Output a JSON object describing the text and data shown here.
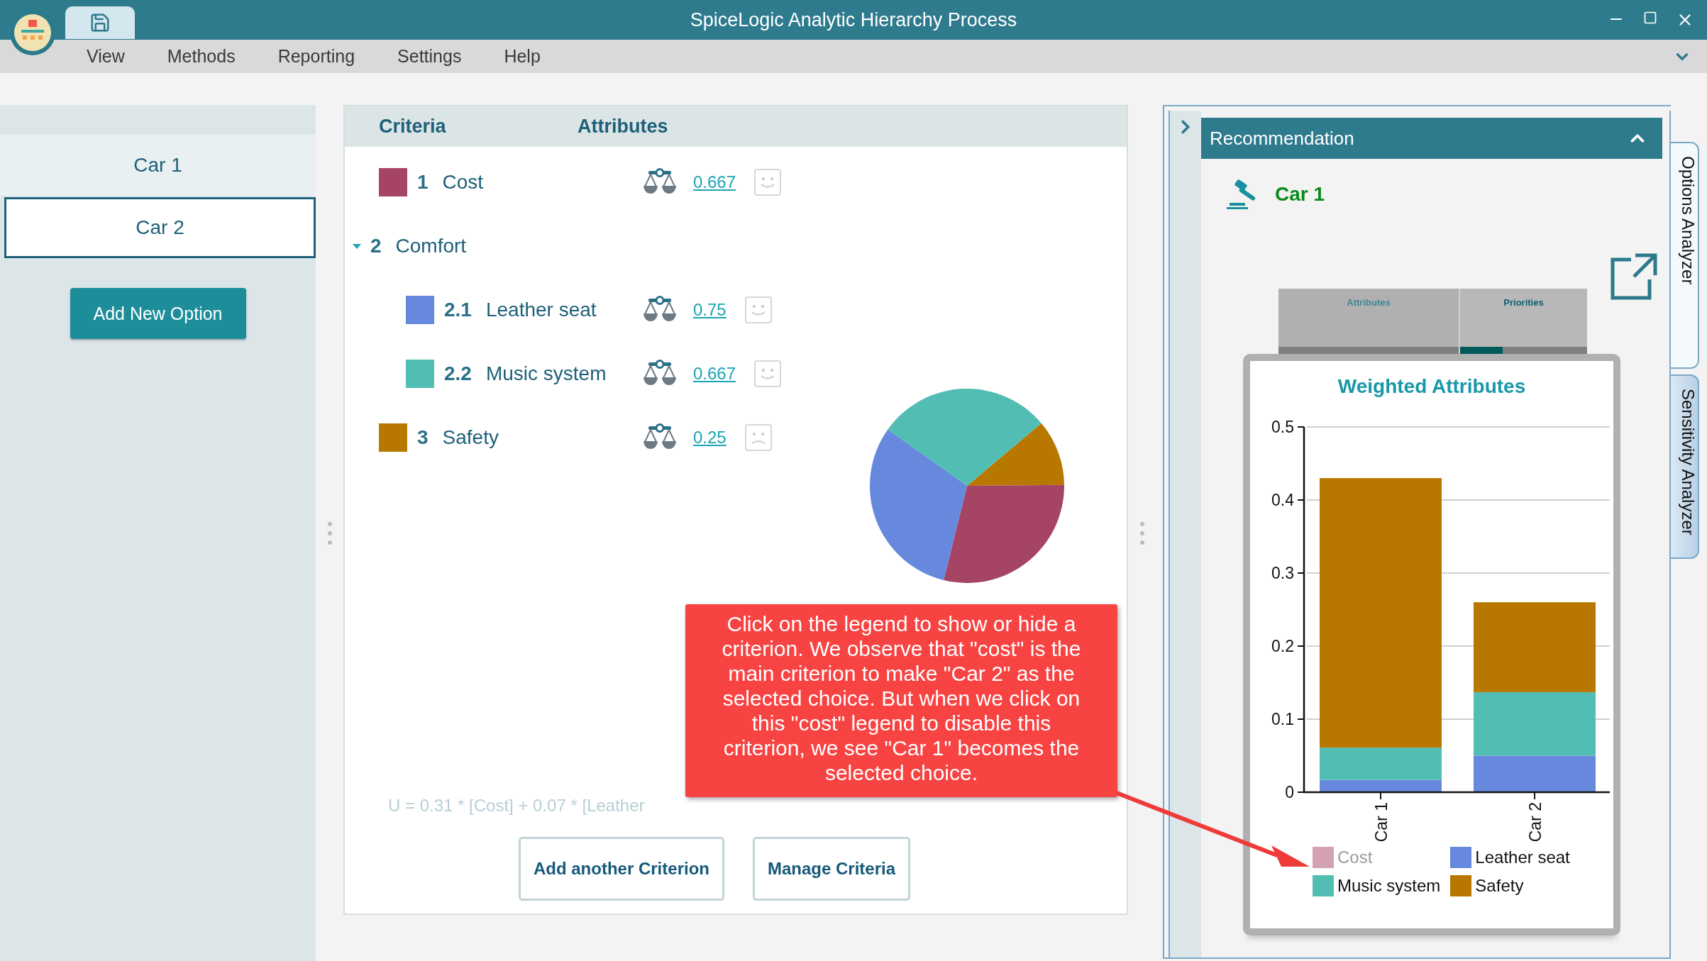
{
  "window": {
    "title": "SpiceLogic Analytic Hierarchy Process"
  },
  "menu": [
    {
      "label": "View"
    },
    {
      "label": "Methods"
    },
    {
      "label": "Reporting"
    },
    {
      "label": "Settings"
    },
    {
      "label": "Help"
    }
  ],
  "options": [
    {
      "label": "Car 1",
      "selected": false
    },
    {
      "label": "Car 2",
      "selected": true
    }
  ],
  "add_option_button": "Add New Option",
  "criteria_panel": {
    "columns": [
      "Criteria",
      "Attributes"
    ],
    "criteria": [
      {
        "number": "1",
        "name": "Cost",
        "color": "#a64466",
        "weight": "0.667",
        "kind": "happy"
      },
      {
        "number": "2",
        "name": "Comfort",
        "expanded": true,
        "children": [
          {
            "number": "2.1",
            "name": "Leather seat",
            "color": "#6688dd",
            "weight": "0.75",
            "kind": "happy"
          },
          {
            "number": "2.2",
            "name": "Music system",
            "color": "#52bdb3",
            "weight": "0.667",
            "kind": "happy"
          }
        ]
      },
      {
        "number": "3",
        "name": "Safety",
        "color": "#b87800",
        "weight": "0.25",
        "kind": "sad"
      }
    ],
    "formula": "U =  0.31 * [Cost] + 0.07 * [Leather",
    "buttons": [
      "Add another Criterion",
      "Manage Criteria"
    ]
  },
  "callout": {
    "text": "Click on the legend to show or hide a criterion. We observe that \"cost\" is the main criterion to make \"Car 2\" as the selected choice. But when we click on this \"cost\" legend to disable this criterion, we see \"Car 1\" becomes the selected choice."
  },
  "recommendation": {
    "title": "Recommendation",
    "expanded": true,
    "winner": "Car 1",
    "tabs": [
      {
        "label": "Attributes",
        "selected": false
      },
      {
        "label": "Priorities",
        "selected": true
      }
    ],
    "chart_data": {
      "type": "bar",
      "title": "Weighted Attributes",
      "categories": [
        "Car 1",
        "Car 2"
      ],
      "stacked": true,
      "grid": true,
      "ylim": [
        0,
        0.5
      ],
      "yticks": [
        0,
        0.1,
        0.2,
        0.3,
        0.4,
        0.5
      ],
      "series": [
        {
          "name": "Cost",
          "color": "#d4a0b4",
          "values": [
            null,
            null
          ]
        },
        {
          "name": "Leather seat",
          "color": "#6688dd",
          "values": [
            0.017,
            0.05
          ]
        },
        {
          "name": "Music system",
          "color": "#52bdb3",
          "values": [
            0.044,
            0.087
          ]
        },
        {
          "name": "Safety",
          "color": "#b87800",
          "values": [
            0.369,
            0.123
          ]
        }
      ]
    },
    "legend_states": [
      {
        "visible": false
      },
      {
        "visible": true
      },
      {
        "visible": true
      },
      {
        "visible": true
      }
    ]
  },
  "side_tabs": [
    {
      "label": "Options Analyzer",
      "selected": true
    },
    {
      "label": "Sensitivity Analyzer",
      "selected": false
    }
  ]
}
